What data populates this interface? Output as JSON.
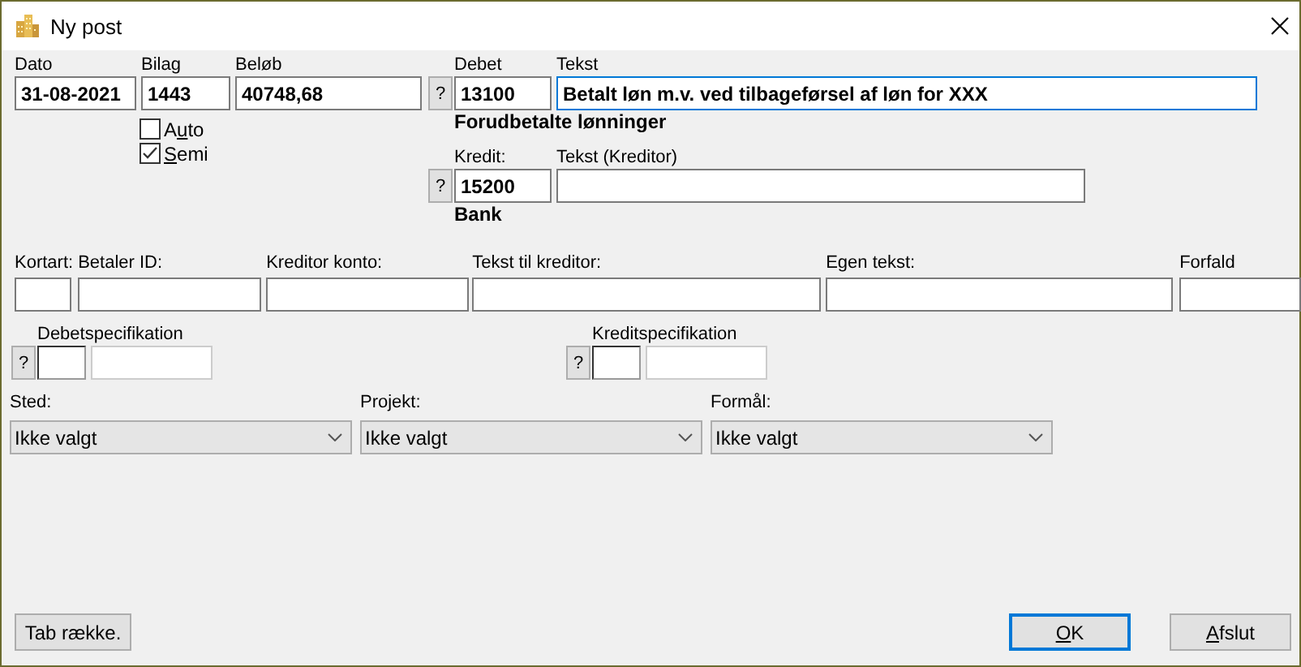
{
  "window": {
    "title": "Ny post"
  },
  "top_fields": [
    {
      "label": "Dato",
      "value": "31-08-2021"
    },
    {
      "label": "Bilag",
      "value": "1443"
    },
    {
      "label": "Beløb",
      "value": "40748,68"
    }
  ],
  "options": [
    {
      "before": "A",
      "key": "u",
      "after": "to",
      "checked": false
    },
    {
      "key": "S",
      "after": "emi",
      "checked": true
    }
  ],
  "accounts": [
    {
      "help": "?",
      "label": "Debet",
      "account": "13100",
      "account_name": "Forudbetalte lønninger",
      "text_label": "Tekst",
      "text": "Betalt løn m.v. ved tilbageførsel af løn for XXX",
      "focused": true
    },
    {
      "help": "?",
      "label": "Kredit:",
      "account": "15200",
      "account_name": "Bank",
      "text_label": "Tekst (Kreditor)",
      "focused": false
    }
  ],
  "payment_fields": [
    {
      "label": "Kortart:"
    },
    {
      "label": "Betaler ID:"
    },
    {
      "label": "Kreditor konto:"
    },
    {
      "label": "Tekst til kreditor:"
    },
    {
      "label": "Egen tekst:"
    },
    {
      "label": "Forfald"
    }
  ],
  "specs": [
    {
      "label": "Debetspecifikation",
      "help": "?"
    },
    {
      "label": "Kreditspecifikation",
      "help": "?"
    }
  ],
  "dropdowns": [
    {
      "label": "Sted:",
      "value": "Ikke valgt"
    },
    {
      "label": "Projekt:",
      "value": "Ikke valgt"
    },
    {
      "label": "Formål:",
      "value": "Ikke valgt"
    }
  ],
  "buttons": [
    {
      "before": "Tab række.",
      "default": false
    },
    {
      "key": "O",
      "after": "K",
      "default": true
    },
    {
      "key": "A",
      "after": "fslut",
      "default": false
    }
  ]
}
